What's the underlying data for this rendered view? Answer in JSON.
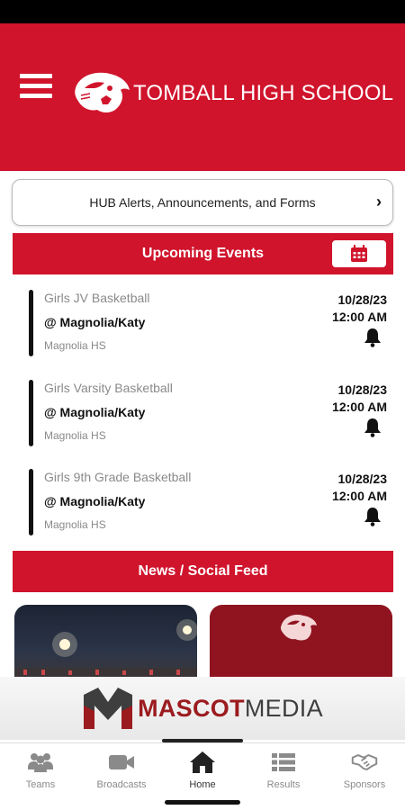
{
  "header": {
    "school_name": "TOMBALL HIGH SCHOOL",
    "brand_color": "#d0142c"
  },
  "hub": {
    "label": "HUB Alerts, Announcements, and Forms"
  },
  "upcoming": {
    "title": "Upcoming Events",
    "events": [
      {
        "sport": "Girls JV Basketball",
        "opponent": "@ Magnolia/Katy",
        "location": "Magnolia HS",
        "date": "10/28/23",
        "time": "12:00 AM"
      },
      {
        "sport": "Girls Varsity Basketball",
        "opponent": "@ Magnolia/Katy",
        "location": "Magnolia HS",
        "date": "10/28/23",
        "time": "12:00 AM"
      },
      {
        "sport": "Girls 9th Grade Basketball",
        "opponent": "@ Magnolia/Katy",
        "location": "Magnolia HS",
        "date": "10/28/23",
        "time": "12:00 AM"
      }
    ]
  },
  "news": {
    "title": "News / Social Feed"
  },
  "sponsor": {
    "brand_part1": "MASCOT",
    "brand_part2": "MEDIA"
  },
  "nav": {
    "items": [
      {
        "label": "Teams",
        "icon": "teams-icon"
      },
      {
        "label": "Broadcasts",
        "icon": "video-camera-icon"
      },
      {
        "label": "Home",
        "icon": "home-icon"
      },
      {
        "label": "Results",
        "icon": "list-icon"
      },
      {
        "label": "Sponsors",
        "icon": "handshake-icon"
      }
    ],
    "active": "Home"
  }
}
